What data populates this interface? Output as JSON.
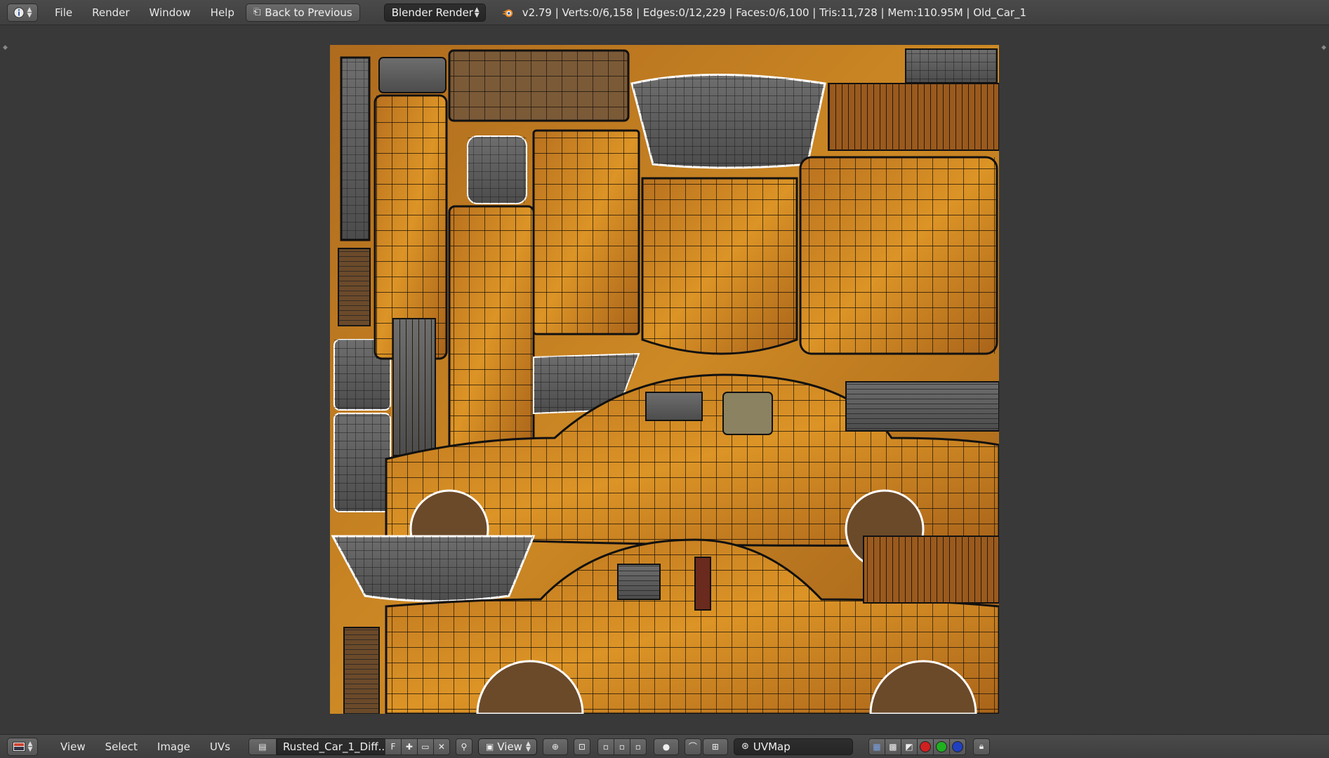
{
  "top_bar": {
    "editor_type_icon": "info-icon",
    "menu": [
      "File",
      "Render",
      "Window",
      "Help"
    ],
    "back_button": "Back to Previous",
    "render_engine": "Blender Render",
    "stats": "v2.79 | Verts:0/6,158 | Edges:0/12,229 | Faces:0/6,100 | Tris:11,728 | Mem:110.95M | Old_Car_1"
  },
  "bottom_bar": {
    "editor_type_icon": "image-editor-icon",
    "menu": [
      "View",
      "Select",
      "Image",
      "UVs"
    ],
    "image_name": "Rusted_Car_1_Diff...",
    "fake_user": "F",
    "view_mode": "View",
    "uv_map": "UVMap"
  },
  "colors": {
    "rust_orange": "#d4891e",
    "dark_panel": "#5e5e5e",
    "background": "#393939"
  }
}
